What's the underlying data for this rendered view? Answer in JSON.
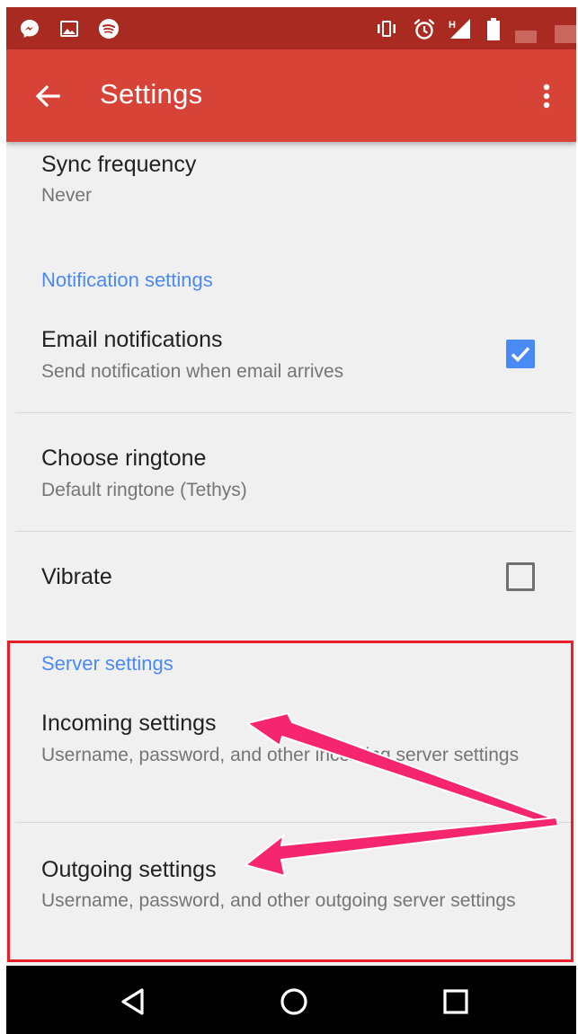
{
  "status_bar": {
    "icons": [
      "messenger-icon",
      "image-icon",
      "spotify-icon",
      "vibrate-icon",
      "alarm-icon",
      "signal-icon",
      "battery-icon"
    ],
    "signal_label": "H"
  },
  "app_bar": {
    "title": "Settings",
    "back_icon": "arrow-left-icon",
    "overflow_icon": "more-vertical-icon"
  },
  "sync": {
    "title": "Sync frequency",
    "summary": "Never"
  },
  "notification_category": "Notification settings",
  "email_notifications": {
    "title": "Email notifications",
    "summary": "Send notification when email arrives",
    "checked": true
  },
  "ringtone": {
    "title": "Choose ringtone",
    "summary": "Default ringtone (Tethys)"
  },
  "vibrate": {
    "title": "Vibrate",
    "checked": false
  },
  "server_category": "Server settings",
  "incoming": {
    "title": "Incoming settings",
    "summary": "Username, password, and other incoming server settings"
  },
  "outgoing": {
    "title": "Outgoing settings",
    "summary": "Username, password, and other outgoing server settings"
  },
  "annotation": {
    "highlight_color": "#e8202a",
    "arrow_color": "#f5266e"
  },
  "colors": {
    "status_bar": "#a82a20",
    "app_bar": "#d84337",
    "accent": "#4a8af4",
    "background": "#f0f0f0"
  },
  "nav_bar": {
    "icons": [
      "back-triangle-icon",
      "home-circle-icon",
      "recents-square-icon"
    ]
  }
}
